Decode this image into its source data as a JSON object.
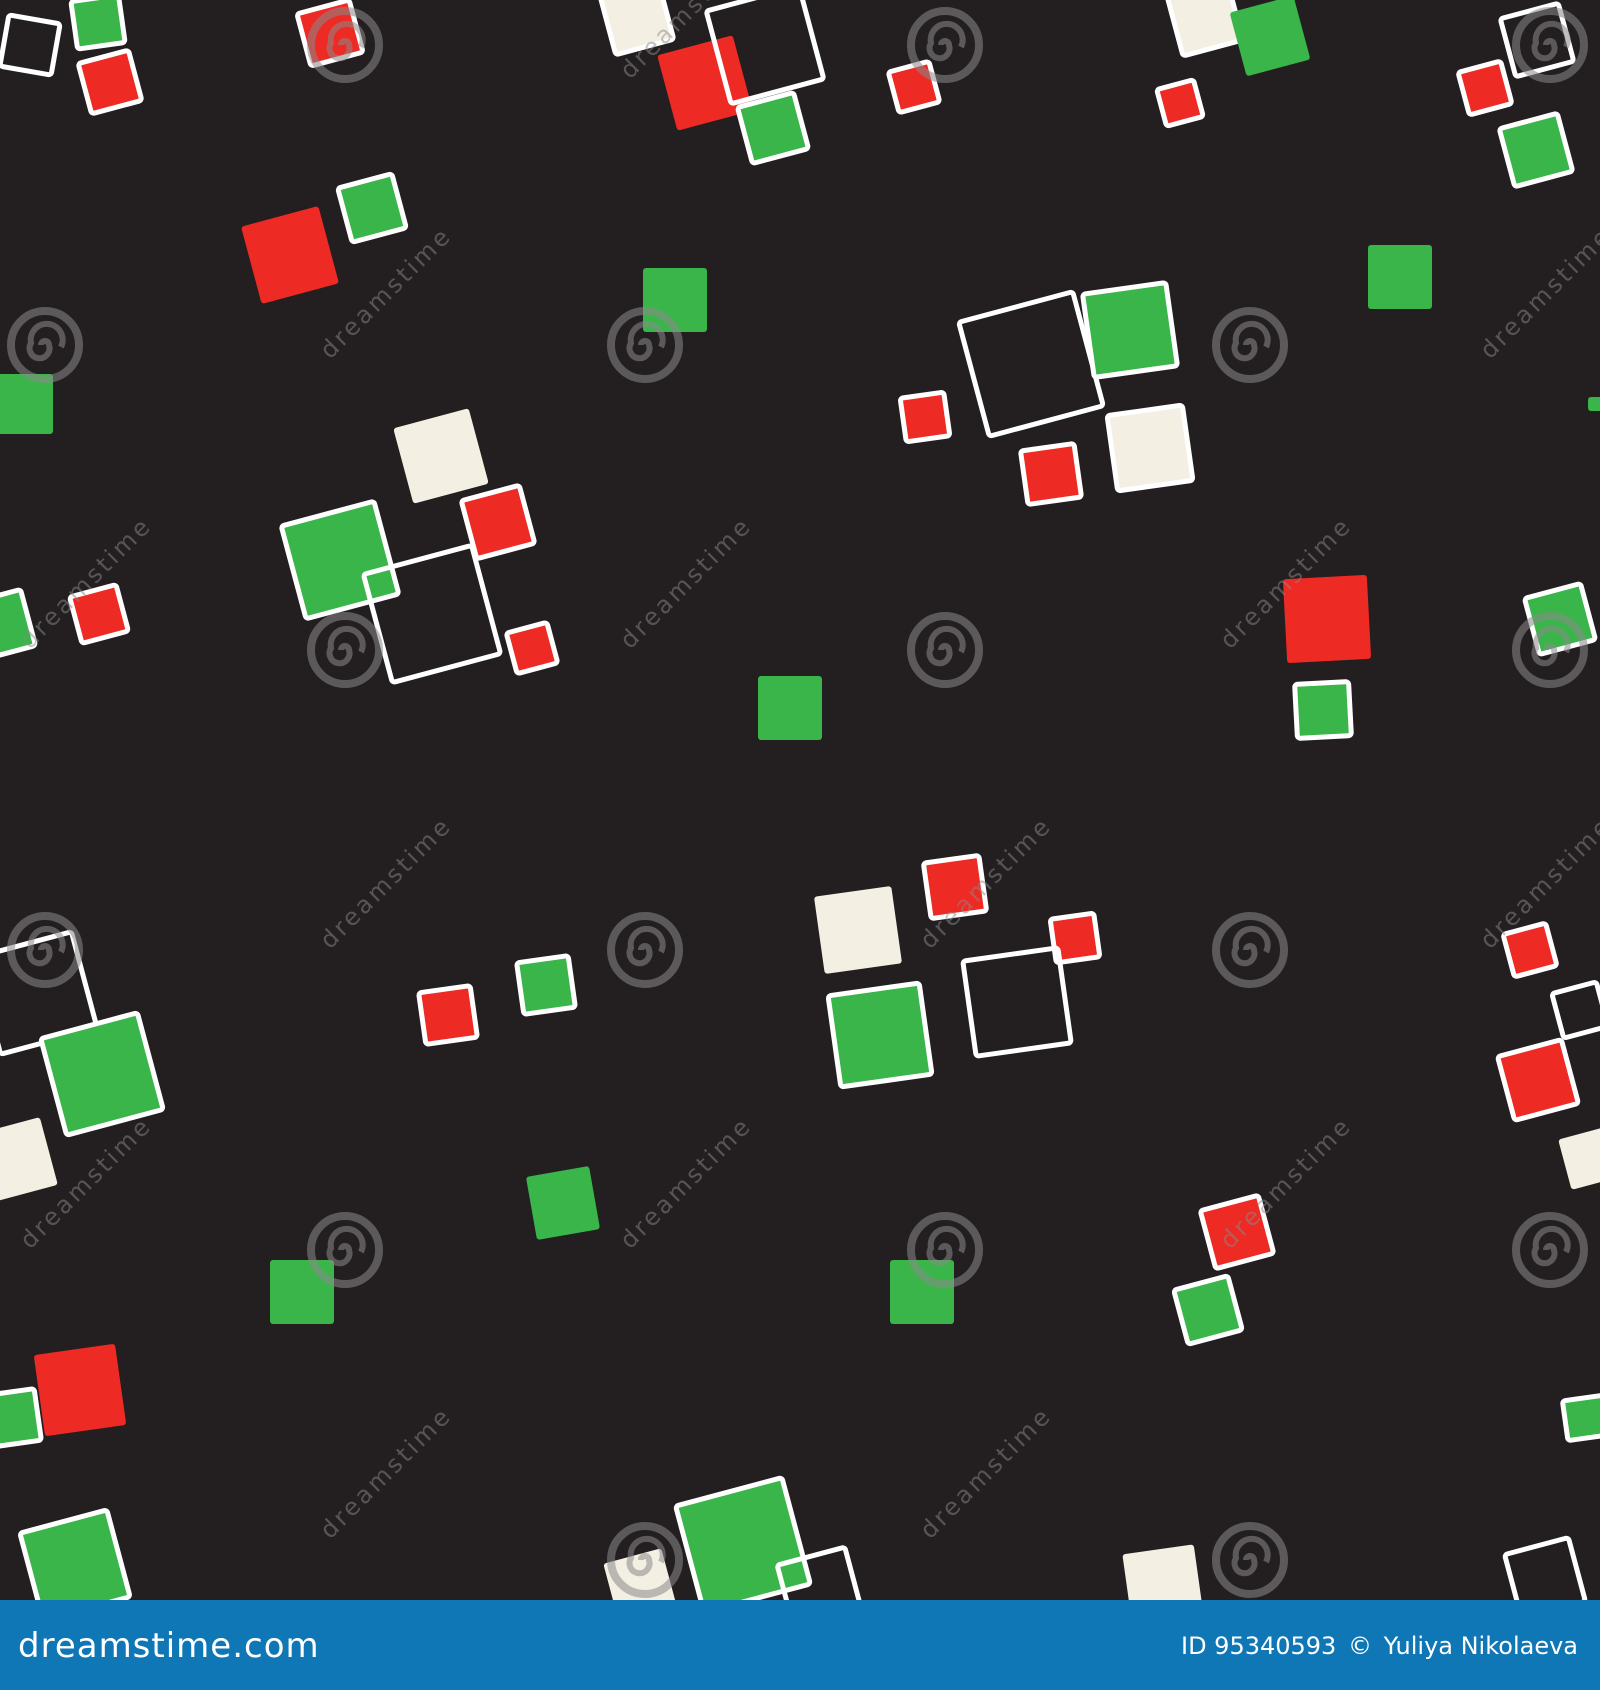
{
  "image": {
    "description_colors": {
      "background": "#231f20",
      "green": "#39b54a",
      "red": "#ee2a24",
      "cream": "#f3efe2",
      "outline": "#ffffff",
      "watermark": "#8a8a8a",
      "footer": "#0f77b5"
    },
    "watermark_text": "dreamstime"
  },
  "footer": {
    "brand": "dreamstime.com",
    "id_text": "ID 95340593",
    "copyright_symbol": "©",
    "author": "Yuliya Nikolaeva"
  }
}
